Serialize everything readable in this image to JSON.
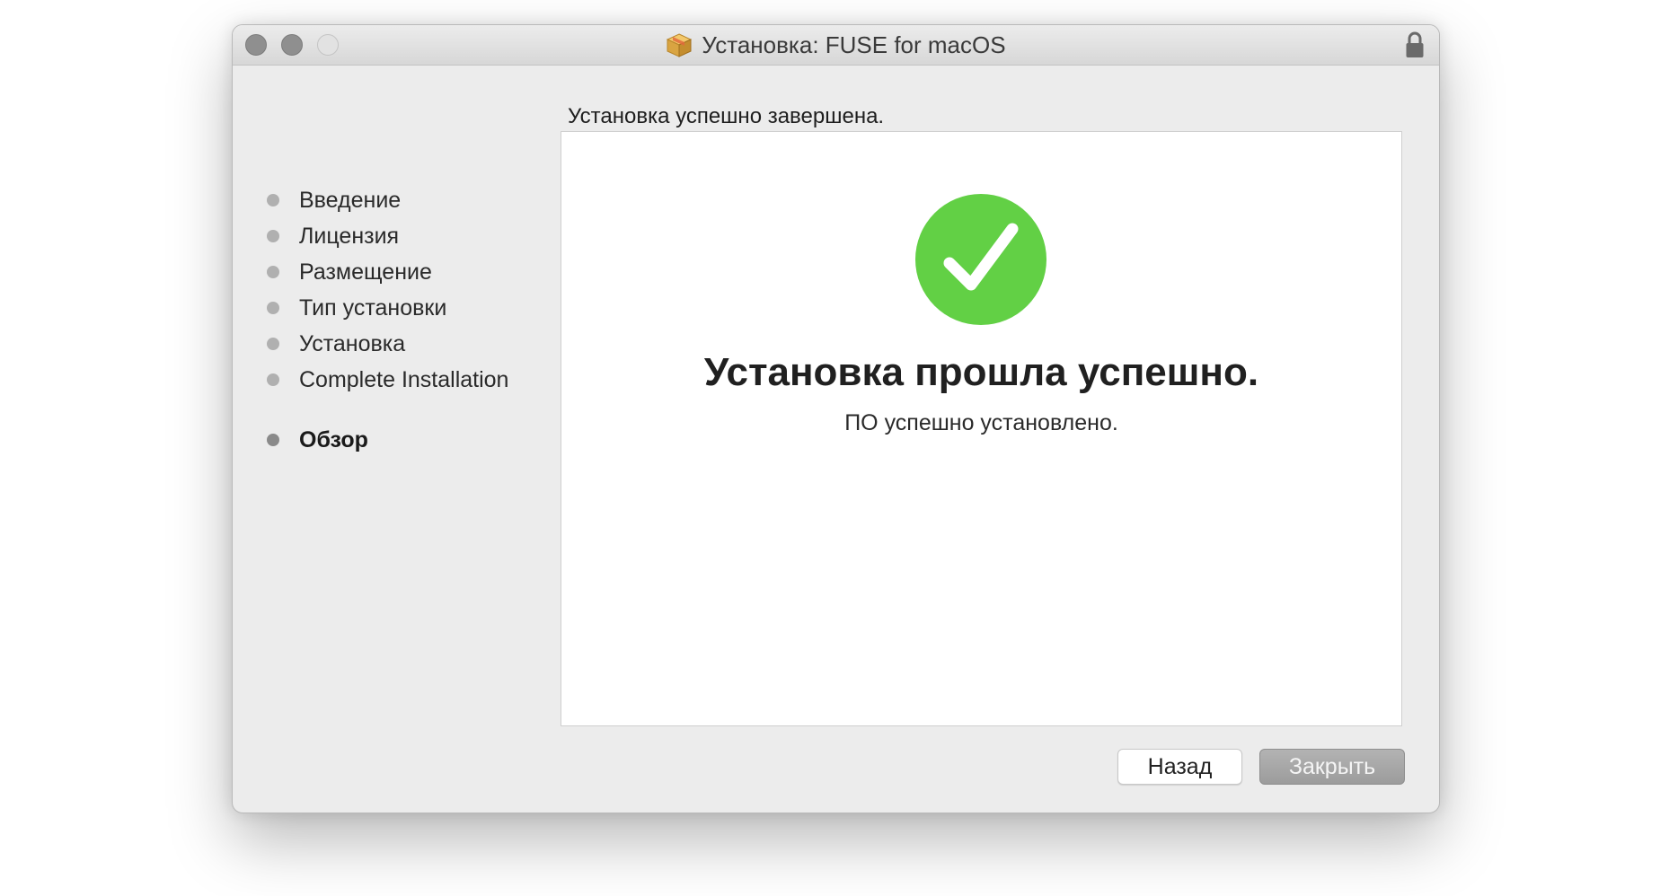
{
  "window": {
    "title": "Установка: FUSE for macOS"
  },
  "header": {
    "status": "Установка успешно завершена."
  },
  "sidebar": {
    "steps": [
      {
        "label": "Введение",
        "state": "done"
      },
      {
        "label": "Лицензия",
        "state": "done"
      },
      {
        "label": "Размещение",
        "state": "done"
      },
      {
        "label": "Тип установки",
        "state": "done"
      },
      {
        "label": "Установка",
        "state": "done"
      },
      {
        "label": "Complete Installation",
        "state": "done"
      },
      {
        "label": "Обзор",
        "state": "current"
      }
    ]
  },
  "main": {
    "icon": "checkmark-circle-icon",
    "title": "Установка прошла успешно.",
    "subtitle": "ПО успешно установлено."
  },
  "buttons": {
    "back_label": "Назад",
    "close_label": "Закрыть"
  },
  "colors": {
    "success_green": "#62d045",
    "default_button": "#a8a8a8"
  }
}
